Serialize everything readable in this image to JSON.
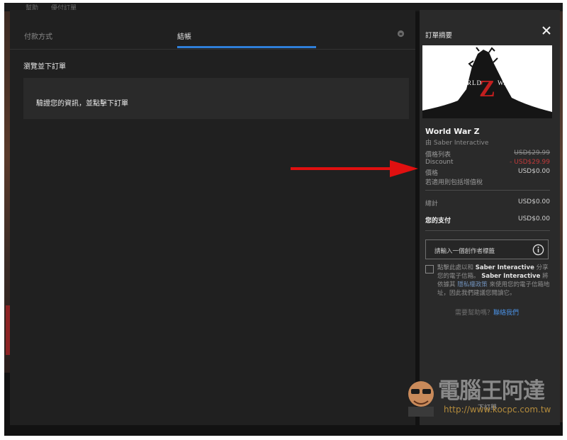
{
  "top_strip": {
    "left_label": "幫助",
    "mid_label": "優付訂單"
  },
  "checkout": {
    "tabs": [
      {
        "label": "付款方式",
        "active": false
      },
      {
        "label": "結帳",
        "active": true
      }
    ],
    "section_title": "瀏覽並下訂單",
    "review_text": "驗證您的資訊，並點擊下訂單"
  },
  "summary": {
    "title": "訂單摘要",
    "game": {
      "title": "World War Z",
      "publisher": "由 Saber Interactive",
      "cover_text_left": "WORLD",
      "cover_letter": "Z",
      "cover_text_right": "WAR"
    },
    "price_rows": [
      {
        "label": "價格列表",
        "value": "USD$29.99",
        "style": "strike"
      },
      {
        "label": "Discount",
        "value": "- USD$29.99",
        "style": "discount"
      },
      {
        "label": "價格",
        "value": "USD$0.00",
        "style": "normal"
      },
      {
        "label": "若適用則包括增值稅",
        "value": "",
        "style": "normal"
      }
    ],
    "total": {
      "label": "總計",
      "value": "USD$0.00"
    },
    "you_pay": {
      "label": "您的支付",
      "value": "USD$0.00"
    },
    "creator_tag_placeholder": "請輸入一個創作者標籤",
    "consent": {
      "part1": "點擊此處以和",
      "company1": "Saber Interactive",
      "part2": "分享您的電子信箱。",
      "company2": "Saber Interactive",
      "part3": "將依據其",
      "policy_link": "隱私權政策",
      "part4": "來使用您的電子信箱地址，因此我們建議您閱讀它。"
    },
    "help": {
      "question": "需要幫助嗎？",
      "link": "聯絡我們"
    },
    "place_order": "下訂單"
  },
  "watermark": {
    "text": "電腦王阿達",
    "url": "http://www.kocpc.com.tw"
  },
  "colors": {
    "accent": "#2f7fd9",
    "discount": "#c23a3a",
    "arrow": "#e01010"
  }
}
